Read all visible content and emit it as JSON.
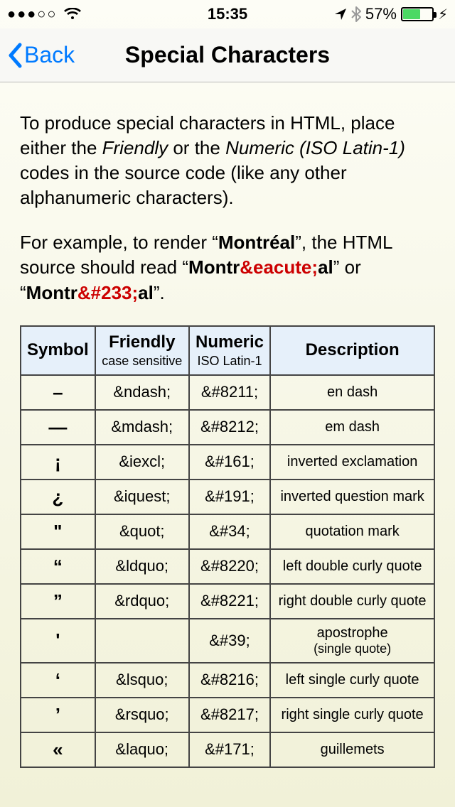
{
  "status": {
    "carrier_dots": "●●●○○",
    "time": "15:35",
    "battery_pct": "57%"
  },
  "nav": {
    "back": "Back",
    "title": "Special Characters"
  },
  "intro": {
    "p1_a": "To produce special characters in HTML, place either the ",
    "p1_friendly": "Friendly",
    "p1_b": " or the ",
    "p1_numeric": "Numeric (ISO Latin-1)",
    "p1_c": " codes in the source code (like any other alphanumeric characters).",
    "p2_a": "For example, to render “",
    "p2_montreal": "Montréal",
    "p2_b": "”, the HTML source should read “",
    "p2_src1a": "Montr",
    "p2_src1b": "&eacute;",
    "p2_src1c": "al",
    "p2_c": "” or “",
    "p2_src2a": "Montr",
    "p2_src2b": "&#233;",
    "p2_src2c": "al",
    "p2_d": "”."
  },
  "table": {
    "headers": {
      "symbol": "Symbol",
      "friendly": "Friendly",
      "friendly_sub": "case sensitive",
      "numeric": "Numeric",
      "numeric_sub": "ISO Latin-1",
      "desc": "Description"
    },
    "rows": [
      {
        "symbol": "–",
        "friendly": "&ndash;",
        "numeric": "&#8211;",
        "desc": "en dash"
      },
      {
        "symbol": "—",
        "friendly": "&mdash;",
        "numeric": "&#8212;",
        "desc": "em dash"
      },
      {
        "symbol": "¡",
        "friendly": "&iexcl;",
        "numeric": "&#161;",
        "desc": "inverted exclamation"
      },
      {
        "symbol": "¿",
        "friendly": "&iquest;",
        "numeric": "&#191;",
        "desc": "inverted question mark"
      },
      {
        "symbol": "\"",
        "friendly": "&quot;",
        "numeric": "&#34;",
        "desc": "quotation mark"
      },
      {
        "symbol": "“",
        "friendly": "&ldquo;",
        "numeric": "&#8220;",
        "desc": "left double curly quote"
      },
      {
        "symbol": "”",
        "friendly": "&rdquo;",
        "numeric": "&#8221;",
        "desc": "right double curly quote"
      },
      {
        "symbol": "'",
        "friendly": "",
        "numeric": "&#39;",
        "desc": "apostrophe",
        "desc_sub": "(single quote)"
      },
      {
        "symbol": "‘",
        "friendly": "&lsquo;",
        "numeric": "&#8216;",
        "desc": "left single curly quote"
      },
      {
        "symbol": "’",
        "friendly": "&rsquo;",
        "numeric": "&#8217;",
        "desc": "right single curly quote"
      },
      {
        "symbol": "«",
        "friendly": "&laquo;",
        "numeric": "&#171;",
        "desc": "guillemets"
      }
    ]
  }
}
